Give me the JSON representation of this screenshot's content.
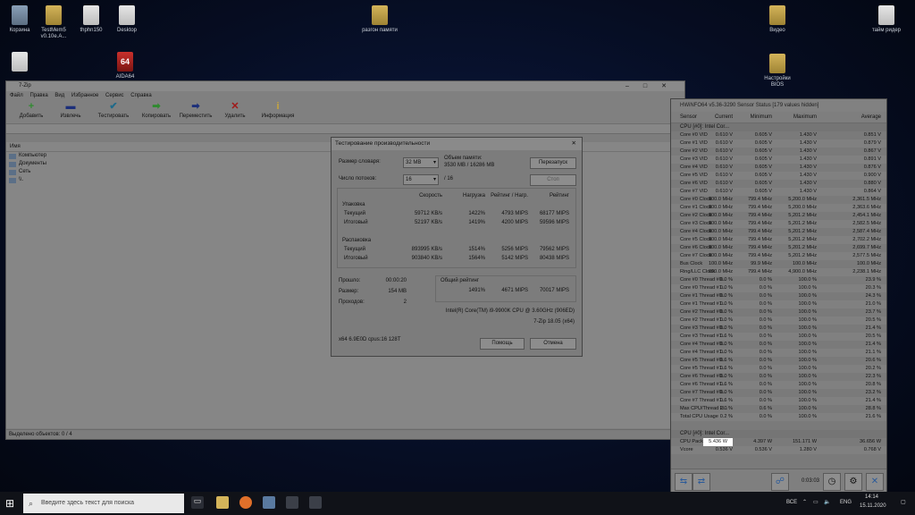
{
  "desktop": {
    "icons": [
      {
        "label": "Корзина",
        "icon": "recycle-bin-icon"
      },
      {
        "label": "TestMem5 v0.10e.A...",
        "icon": "folder-icon"
      },
      {
        "label": "thphn150",
        "icon": "file-icon"
      },
      {
        "label": "Desktop",
        "icon": "file-icon"
      },
      {
        "label": "разгон памяти",
        "icon": "folder-icon"
      },
      {
        "label": "Видео",
        "icon": "folder-icon"
      },
      {
        "label": "тайм ридер",
        "icon": "file-icon"
      },
      {
        "label": "Настройки BIOS",
        "icon": "folder-icon"
      },
      {
        "label": "AIDA64",
        "icon": "aida-icon"
      },
      {
        "label": "",
        "icon": "file-icon"
      }
    ]
  },
  "sevenzip": {
    "title": "7-Zip",
    "menu": [
      "Файл",
      "Правка",
      "Вид",
      "Избранное",
      "Сервис",
      "Справка"
    ],
    "toolbar": [
      "Добавить",
      "Извлечь",
      "Тестировать",
      "Копировать",
      "Переместить",
      "Удалить",
      "Информация"
    ],
    "column_name": "Имя",
    "items": [
      "Компьютер",
      "Документы",
      "Сеть",
      "\\\\."
    ],
    "status": "Выделено объектов: 0 / 4"
  },
  "benchmark": {
    "title": "Тестирование производительности",
    "dict_label": "Размер словаря:",
    "dict_value": "32 MB",
    "mem_label": "Объем памяти:",
    "mem_value": "3530 MB / 16286 MB",
    "restart": "Перезапуск",
    "stop": "Стоп",
    "threads_label": "Число потоков:",
    "threads_value": "16",
    "threads_max": "/ 16",
    "headers": [
      "Скорость",
      "Нагрузка",
      "Рейтинг / Нагр.",
      "Рейтинг"
    ],
    "compress_label": "Упаковка",
    "current_label": "Текущий",
    "total_label": "Итоговый",
    "compress_current": [
      "59712 KB/s",
      "1422%",
      "4793 MIPS",
      "68177 MIPS"
    ],
    "compress_total": [
      "52197 KB/s",
      "1419%",
      "4200 MIPS",
      "59596 MIPS"
    ],
    "decompress_label": "Распаковка",
    "decompress_current": [
      "893995 KB/s",
      "1514%",
      "5256 MIPS",
      "79562 MIPS"
    ],
    "decompress_total": [
      "903840 KB/s",
      "1564%",
      "5142 MIPS",
      "80438 MIPS"
    ],
    "elapsed_label": "Прошло:",
    "elapsed_value": "00:00:20",
    "size_label": "Размер:",
    "size_value": "154 MB",
    "passes_label": "Проходов:",
    "passes_value": "2",
    "overall_label": "Общий рейтинг",
    "overall": [
      "1491%",
      "4671 MIPS",
      "70017 MIPS"
    ],
    "cpu": "Intel(R) Core(TM) i9-9900K CPU @ 3.60GHz (906ED)",
    "version": "7-Zip 18.05 (x64)",
    "sysinfo": "x64 6.9E0D cpus:16 128T",
    "help": "Помощь",
    "cancel": "Отмена"
  },
  "hwinfo": {
    "title": "HWiNFO64 v5.36-3290 Sensor Status [179 values hidden]",
    "columns": [
      "Sensor",
      "Current",
      "Minimum",
      "Maximum",
      "Average"
    ],
    "group1": "CPU [#0]: Intel Cor...",
    "rows": [
      [
        "Core #0 VID",
        "0.610 V",
        "0.605 V",
        "1.430 V",
        "0.851 V"
      ],
      [
        "Core #1 VID",
        "0.610 V",
        "0.605 V",
        "1.430 V",
        "0.879 V"
      ],
      [
        "Core #2 VID",
        "0.610 V",
        "0.605 V",
        "1.430 V",
        "0.867 V"
      ],
      [
        "Core #3 VID",
        "0.610 V",
        "0.605 V",
        "1.430 V",
        "0.891 V"
      ],
      [
        "Core #4 VID",
        "0.610 V",
        "0.605 V",
        "1.430 V",
        "0.876 V"
      ],
      [
        "Core #5 VID",
        "0.610 V",
        "0.605 V",
        "1.430 V",
        "0.900 V"
      ],
      [
        "Core #6 VID",
        "0.610 V",
        "0.605 V",
        "1.430 V",
        "0.880 V"
      ],
      [
        "Core #7 VID",
        "0.610 V",
        "0.605 V",
        "1.430 V",
        "0.864 V"
      ],
      [
        "Core #0 Clock",
        "800.0 MHz",
        "799.4 MHz",
        "5,200.0 MHz",
        "2,361.5 MHz"
      ],
      [
        "Core #1 Clock",
        "800.0 MHz",
        "799.4 MHz",
        "5,200.0 MHz",
        "2,363.6 MHz"
      ],
      [
        "Core #2 Clock",
        "800.0 MHz",
        "799.4 MHz",
        "5,201.2 MHz",
        "2,454.1 MHz"
      ],
      [
        "Core #3 Clock",
        "800.0 MHz",
        "799.4 MHz",
        "5,201.2 MHz",
        "2,582.5 MHz"
      ],
      [
        "Core #4 Clock",
        "800.0 MHz",
        "799.4 MHz",
        "5,201.2 MHz",
        "2,587.4 MHz"
      ],
      [
        "Core #5 Clock",
        "800.0 MHz",
        "799.4 MHz",
        "5,201.2 MHz",
        "2,702.2 MHz"
      ],
      [
        "Core #6 Clock",
        "800.0 MHz",
        "799.4 MHz",
        "5,201.2 MHz",
        "2,699.7 MHz"
      ],
      [
        "Core #7 Clock",
        "800.0 MHz",
        "799.4 MHz",
        "5,201.2 MHz",
        "2,577.5 MHz"
      ],
      [
        "Bus Clock",
        "100.0 MHz",
        "99.9 MHz",
        "100.0 MHz",
        "100.0 MHz"
      ],
      [
        "Ring/LLC Clock",
        "800.0 MHz",
        "799.4 MHz",
        "4,900.0 MHz",
        "2,238.1 MHz"
      ],
      [
        "Core #0 Thread #0...",
        "0.0 %",
        "0.0 %",
        "100.0 %",
        "23.9 %"
      ],
      [
        "Core #0 Thread #1...",
        "0.0 %",
        "0.0 %",
        "100.0 %",
        "20.3 %"
      ],
      [
        "Core #1 Thread #0...",
        "0.0 %",
        "0.0 %",
        "100.0 %",
        "24.3 %"
      ],
      [
        "Core #1 Thread #1...",
        "0.0 %",
        "0.0 %",
        "100.0 %",
        "21.0 %"
      ],
      [
        "Core #2 Thread #0...",
        "0.0 %",
        "0.0 %",
        "100.0 %",
        "23.7 %"
      ],
      [
        "Core #2 Thread #1...",
        "0.0 %",
        "0.0 %",
        "100.0 %",
        "20.5 %"
      ],
      [
        "Core #3 Thread #0...",
        "0.0 %",
        "0.0 %",
        "100.0 %",
        "21.4 %"
      ],
      [
        "Core #3 Thread #1...",
        "0.6 %",
        "0.0 %",
        "100.0 %",
        "20.5 %"
      ],
      [
        "Core #4 Thread #0...",
        "0.0 %",
        "0.0 %",
        "100.0 %",
        "21.4 %"
      ],
      [
        "Core #4 Thread #1...",
        "0.0 %",
        "0.0 %",
        "100.0 %",
        "21.1 %"
      ],
      [
        "Core #5 Thread #0...",
        "0.6 %",
        "0.0 %",
        "100.0 %",
        "20.6 %"
      ],
      [
        "Core #5 Thread #1...",
        "0.6 %",
        "0.0 %",
        "100.0 %",
        "20.2 %"
      ],
      [
        "Core #6 Thread #0...",
        "0.0 %",
        "0.0 %",
        "100.0 %",
        "22.3 %"
      ],
      [
        "Core #6 Thread #1...",
        "0.6 %",
        "0.0 %",
        "100.0 %",
        "20.8 %"
      ],
      [
        "Core #7 Thread #0...",
        "0.0 %",
        "0.0 %",
        "100.0 %",
        "23.2 %"
      ],
      [
        "Core #7 Thread #1...",
        "0.6 %",
        "0.0 %",
        "100.0 %",
        "21.4 %"
      ],
      [
        "Max CPU/Thread U...",
        "2.0 %",
        "0.6 %",
        "100.0 %",
        "28.8 %"
      ],
      [
        "Total CPU Usage",
        "0.2 %",
        "0.0 %",
        "100.0 %",
        "21.6 %"
      ]
    ],
    "group2": "CPU [#0]: Intel Cor...",
    "power_rows": [
      [
        "CPU Package Power",
        "5.436 W",
        "4.397 W",
        "151.171 W",
        "36.656 W"
      ],
      [
        "Vcore",
        "0.536 V",
        "0.536 V",
        "1.280 V",
        "0.768 V"
      ]
    ],
    "timer": "0:03:03"
  },
  "taskbar": {
    "search_placeholder": "Введите здесь текст для поиска",
    "tray_all": "ВСЕ",
    "lang": "ENG",
    "time": "14:14",
    "date": "15.11.2020"
  }
}
